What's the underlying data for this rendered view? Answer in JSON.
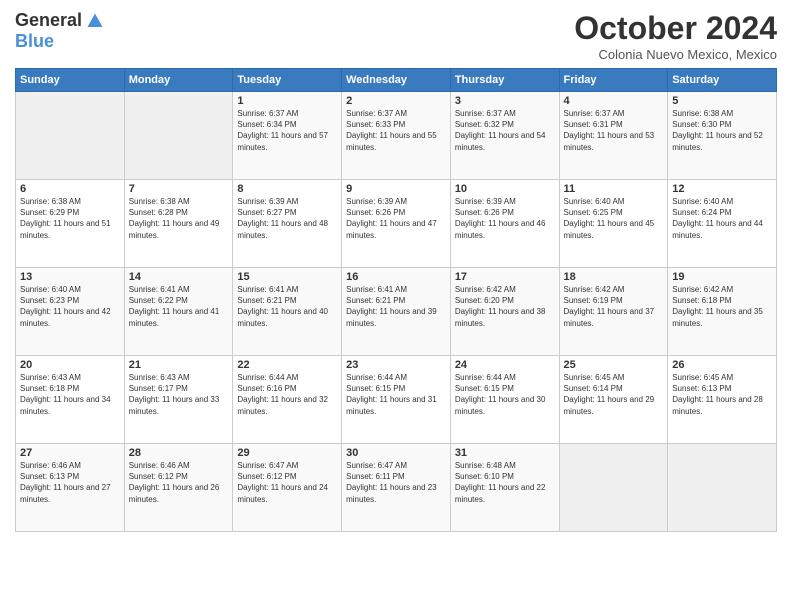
{
  "logo": {
    "general": "General",
    "blue": "Blue"
  },
  "title": "October 2024",
  "subtitle": "Colonia Nuevo Mexico, Mexico",
  "days": [
    "Sunday",
    "Monday",
    "Tuesday",
    "Wednesday",
    "Thursday",
    "Friday",
    "Saturday"
  ],
  "weeks": [
    [
      {
        "day": "",
        "info": ""
      },
      {
        "day": "",
        "info": ""
      },
      {
        "day": "1",
        "info": "Sunrise: 6:37 AM\nSunset: 6:34 PM\nDaylight: 11 hours and 57 minutes."
      },
      {
        "day": "2",
        "info": "Sunrise: 6:37 AM\nSunset: 6:33 PM\nDaylight: 11 hours and 55 minutes."
      },
      {
        "day": "3",
        "info": "Sunrise: 6:37 AM\nSunset: 6:32 PM\nDaylight: 11 hours and 54 minutes."
      },
      {
        "day": "4",
        "info": "Sunrise: 6:37 AM\nSunset: 6:31 PM\nDaylight: 11 hours and 53 minutes."
      },
      {
        "day": "5",
        "info": "Sunrise: 6:38 AM\nSunset: 6:30 PM\nDaylight: 11 hours and 52 minutes."
      }
    ],
    [
      {
        "day": "6",
        "info": "Sunrise: 6:38 AM\nSunset: 6:29 PM\nDaylight: 11 hours and 51 minutes."
      },
      {
        "day": "7",
        "info": "Sunrise: 6:38 AM\nSunset: 6:28 PM\nDaylight: 11 hours and 49 minutes."
      },
      {
        "day": "8",
        "info": "Sunrise: 6:39 AM\nSunset: 6:27 PM\nDaylight: 11 hours and 48 minutes."
      },
      {
        "day": "9",
        "info": "Sunrise: 6:39 AM\nSunset: 6:26 PM\nDaylight: 11 hours and 47 minutes."
      },
      {
        "day": "10",
        "info": "Sunrise: 6:39 AM\nSunset: 6:26 PM\nDaylight: 11 hours and 46 minutes."
      },
      {
        "day": "11",
        "info": "Sunrise: 6:40 AM\nSunset: 6:25 PM\nDaylight: 11 hours and 45 minutes."
      },
      {
        "day": "12",
        "info": "Sunrise: 6:40 AM\nSunset: 6:24 PM\nDaylight: 11 hours and 44 minutes."
      }
    ],
    [
      {
        "day": "13",
        "info": "Sunrise: 6:40 AM\nSunset: 6:23 PM\nDaylight: 11 hours and 42 minutes."
      },
      {
        "day": "14",
        "info": "Sunrise: 6:41 AM\nSunset: 6:22 PM\nDaylight: 11 hours and 41 minutes."
      },
      {
        "day": "15",
        "info": "Sunrise: 6:41 AM\nSunset: 6:21 PM\nDaylight: 11 hours and 40 minutes."
      },
      {
        "day": "16",
        "info": "Sunrise: 6:41 AM\nSunset: 6:21 PM\nDaylight: 11 hours and 39 minutes."
      },
      {
        "day": "17",
        "info": "Sunrise: 6:42 AM\nSunset: 6:20 PM\nDaylight: 11 hours and 38 minutes."
      },
      {
        "day": "18",
        "info": "Sunrise: 6:42 AM\nSunset: 6:19 PM\nDaylight: 11 hours and 37 minutes."
      },
      {
        "day": "19",
        "info": "Sunrise: 6:42 AM\nSunset: 6:18 PM\nDaylight: 11 hours and 35 minutes."
      }
    ],
    [
      {
        "day": "20",
        "info": "Sunrise: 6:43 AM\nSunset: 6:18 PM\nDaylight: 11 hours and 34 minutes."
      },
      {
        "day": "21",
        "info": "Sunrise: 6:43 AM\nSunset: 6:17 PM\nDaylight: 11 hours and 33 minutes."
      },
      {
        "day": "22",
        "info": "Sunrise: 6:44 AM\nSunset: 6:16 PM\nDaylight: 11 hours and 32 minutes."
      },
      {
        "day": "23",
        "info": "Sunrise: 6:44 AM\nSunset: 6:15 PM\nDaylight: 11 hours and 31 minutes."
      },
      {
        "day": "24",
        "info": "Sunrise: 6:44 AM\nSunset: 6:15 PM\nDaylight: 11 hours and 30 minutes."
      },
      {
        "day": "25",
        "info": "Sunrise: 6:45 AM\nSunset: 6:14 PM\nDaylight: 11 hours and 29 minutes."
      },
      {
        "day": "26",
        "info": "Sunrise: 6:45 AM\nSunset: 6:13 PM\nDaylight: 11 hours and 28 minutes."
      }
    ],
    [
      {
        "day": "27",
        "info": "Sunrise: 6:46 AM\nSunset: 6:13 PM\nDaylight: 11 hours and 27 minutes."
      },
      {
        "day": "28",
        "info": "Sunrise: 6:46 AM\nSunset: 6:12 PM\nDaylight: 11 hours and 26 minutes."
      },
      {
        "day": "29",
        "info": "Sunrise: 6:47 AM\nSunset: 6:12 PM\nDaylight: 11 hours and 24 minutes."
      },
      {
        "day": "30",
        "info": "Sunrise: 6:47 AM\nSunset: 6:11 PM\nDaylight: 11 hours and 23 minutes."
      },
      {
        "day": "31",
        "info": "Sunrise: 6:48 AM\nSunset: 6:10 PM\nDaylight: 11 hours and 22 minutes."
      },
      {
        "day": "",
        "info": ""
      },
      {
        "day": "",
        "info": ""
      }
    ]
  ]
}
